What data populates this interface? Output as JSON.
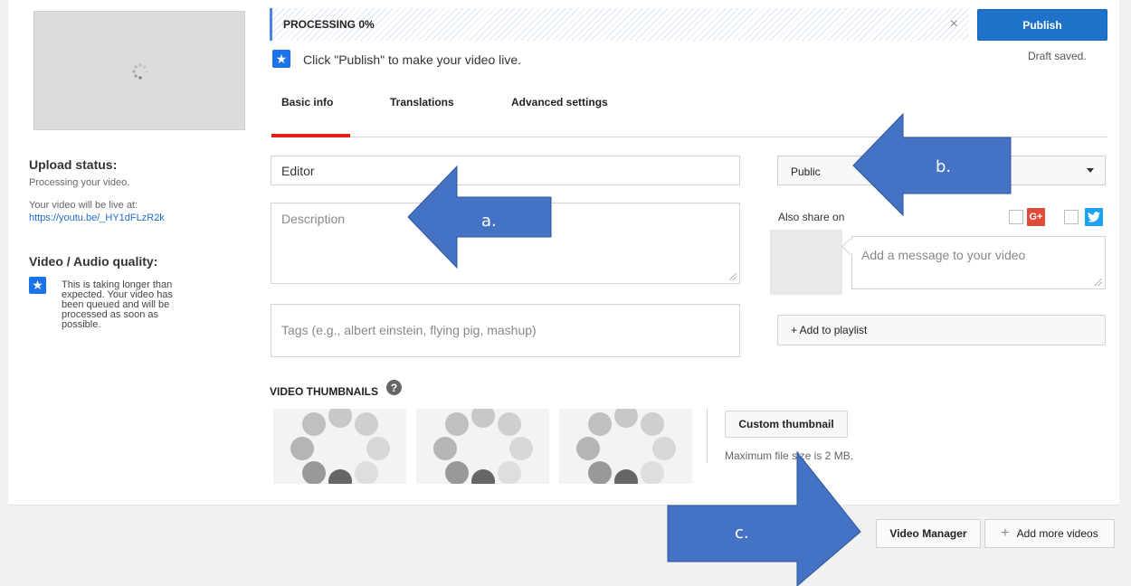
{
  "progress": {
    "label": "PROCESSING 0%",
    "close": "×"
  },
  "publish": {
    "label": "Publish",
    "draft_status": "Draft saved."
  },
  "hint": {
    "text": "Click \"Publish\" to make your video live."
  },
  "tabs": [
    {
      "label": "Basic info",
      "active": true
    },
    {
      "label": "Translations",
      "active": false
    },
    {
      "label": "Advanced settings",
      "active": false
    }
  ],
  "sidebar": {
    "upload_status_title": "Upload status:",
    "upload_status_text": "Processing your video.",
    "live_at_text": "Your video will be live at:",
    "video_url": "https://youtu.be/_HY1dFLzR2k",
    "quality_title": "Video / Audio quality:",
    "quality_lines": [
      "This is taking longer than",
      "expected. Your video has",
      "been queued and will be",
      "processed as soon as",
      "possible."
    ]
  },
  "form": {
    "title_value": "Editor",
    "description_placeholder": "Description",
    "tags_placeholder": "Tags (e.g., albert einstein, flying pig, mashup)"
  },
  "privacy": {
    "selected": "Public"
  },
  "share": {
    "label": "Also share on",
    "gplus": "G+",
    "message_placeholder": "Add a message to your video"
  },
  "playlist": {
    "label": "+ Add to playlist"
  },
  "thumbnails": {
    "title": "VIDEO THUMBNAILS",
    "help": "?",
    "custom_label": "Custom thumbnail",
    "max_size": "Maximum file size is 2 MB."
  },
  "footer": {
    "video_manager": "Video Manager",
    "add_more_plus": "+",
    "add_more": "Add more videos"
  },
  "annotations": {
    "a": "a.",
    "b": "b.",
    "c": "c."
  },
  "colors": {
    "publish": "#1f72c9",
    "tab_active": "#e62117",
    "arrow_fill": "#4472c4",
    "link": "#1f6fd0"
  }
}
